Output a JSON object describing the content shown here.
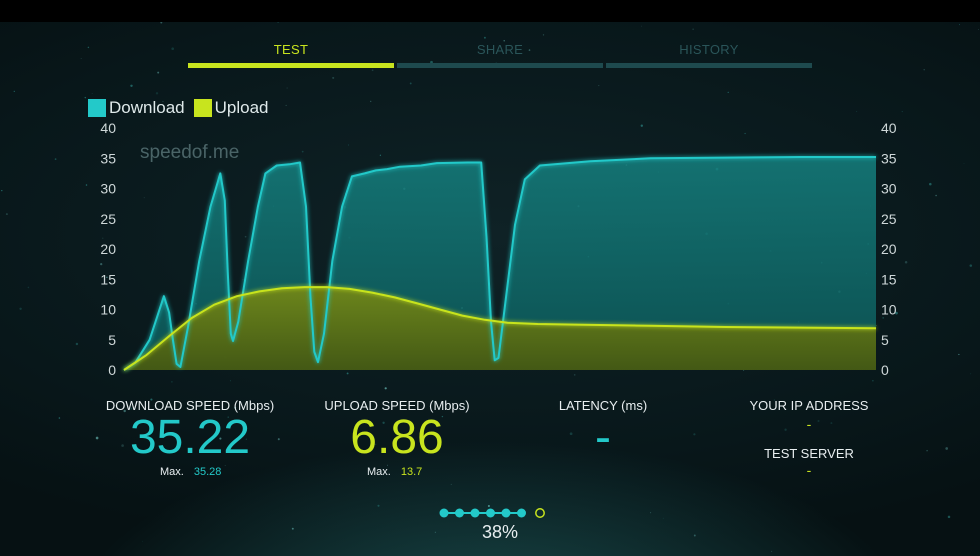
{
  "tabs": [
    {
      "label": "TEST",
      "active": true
    },
    {
      "label": "SHARE",
      "active": false
    },
    {
      "label": "HISTORY",
      "active": false
    }
  ],
  "legend": [
    {
      "label": "Download",
      "color": "#23c9c9"
    },
    {
      "label": "Upload",
      "color": "#c8e41e"
    }
  ],
  "watermark": "speedof.me",
  "chart_data": {
    "type": "area",
    "ylim": [
      0,
      40
    ],
    "yticks": [
      0,
      5,
      10,
      15,
      20,
      25,
      30,
      35,
      40
    ],
    "xlim": [
      0,
      100
    ],
    "series": [
      {
        "name": "Download",
        "color": "#23c9c9",
        "points": [
          [
            0,
            0
          ],
          [
            1.5,
            1.2
          ],
          [
            3.4,
            5
          ],
          [
            5.3,
            12.2
          ],
          [
            6.0,
            9.5
          ],
          [
            6.5,
            5
          ],
          [
            7.0,
            1.0
          ],
          [
            7.5,
            0.5
          ],
          [
            8.5,
            7
          ],
          [
            10,
            18
          ],
          [
            11.5,
            27
          ],
          [
            12.8,
            32.5
          ],
          [
            13.4,
            28
          ],
          [
            13.8,
            16
          ],
          [
            14.2,
            6
          ],
          [
            14.5,
            4.8
          ],
          [
            15.2,
            8
          ],
          [
            16.5,
            18
          ],
          [
            17.8,
            27
          ],
          [
            18.8,
            32.5
          ],
          [
            20.3,
            33.8
          ],
          [
            22,
            34
          ],
          [
            23.4,
            34.3
          ],
          [
            24.2,
            27
          ],
          [
            24.8,
            12
          ],
          [
            25.3,
            3
          ],
          [
            25.8,
            1.3
          ],
          [
            26.6,
            6
          ],
          [
            27.7,
            18
          ],
          [
            29,
            27
          ],
          [
            30.3,
            32
          ],
          [
            32,
            32.5
          ],
          [
            33.5,
            33
          ],
          [
            35,
            33.2
          ],
          [
            36.7,
            33.6
          ],
          [
            39.5,
            33.8
          ],
          [
            41.6,
            34.2
          ],
          [
            45.7,
            34.3
          ],
          [
            47.5,
            34.3
          ],
          [
            48.2,
            22
          ],
          [
            48.8,
            8
          ],
          [
            49.3,
            1.6
          ],
          [
            49.8,
            2
          ],
          [
            50.8,
            12
          ],
          [
            52,
            24
          ],
          [
            53.3,
            31.5
          ],
          [
            55.3,
            33.8
          ],
          [
            62,
            34.5
          ],
          [
            70,
            35
          ],
          [
            80,
            35.1
          ],
          [
            90,
            35.2
          ],
          [
            100,
            35.2
          ]
        ]
      },
      {
        "name": "Upload",
        "color": "#c8e41e",
        "points": [
          [
            0,
            0
          ],
          [
            3,
            2.5
          ],
          [
            6,
            5.6
          ],
          [
            9,
            8.6
          ],
          [
            12,
            10.8
          ],
          [
            15,
            12.2
          ],
          [
            18,
            13
          ],
          [
            21,
            13.5
          ],
          [
            24,
            13.7
          ],
          [
            27,
            13.7
          ],
          [
            30,
            13.4
          ],
          [
            33,
            12.8
          ],
          [
            36,
            12
          ],
          [
            39,
            11
          ],
          [
            42,
            10
          ],
          [
            45,
            9
          ],
          [
            48,
            8.3
          ],
          [
            51,
            7.8
          ],
          [
            55,
            7.6
          ],
          [
            60,
            7.5
          ],
          [
            70,
            7.3
          ],
          [
            80,
            7.1
          ],
          [
            90,
            7.0
          ],
          [
            100,
            6.9
          ]
        ]
      }
    ]
  },
  "stats": {
    "download": {
      "label": "DOWNLOAD SPEED (Mbps)",
      "value": "35.22",
      "max_label": "Max.",
      "max_value": "35.28"
    },
    "upload": {
      "label": "UPLOAD SPEED (Mbps)",
      "value": "6.86",
      "max_label": "Max.",
      "max_value": "13.7"
    },
    "latency": {
      "label": "LATENCY (ms)",
      "value": "-"
    },
    "ip": {
      "label": "YOUR IP ADDRESS",
      "value": "-"
    },
    "server": {
      "label": "TEST SERVER",
      "value": "-"
    }
  },
  "progress": {
    "percent_label": "38%",
    "total_steps": 7,
    "completed_steps": 6,
    "completed_color": "#23c9c9",
    "current_color": "#c8e41e"
  }
}
